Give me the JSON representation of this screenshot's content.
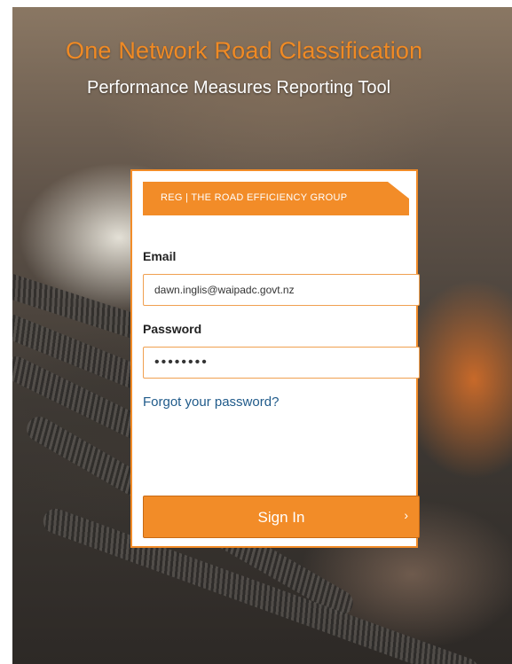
{
  "header": {
    "title": "One Network Road Classification",
    "subtitle": "Performance Measures Reporting Tool"
  },
  "brand": {
    "text": "REG  |  THE ROAD EFFICIENCY GROUP",
    "color": "#f28c28"
  },
  "form": {
    "email_label": "Email",
    "email_value": "dawn.inglis@waipadc.govt.nz",
    "password_label": "Password",
    "password_value": "••••••••",
    "forgot_link": "Forgot your password?",
    "signin_label": "Sign In",
    "signin_icon": "chevron-right-icon"
  },
  "colors": {
    "accent": "#f28c28",
    "link": "#1f5a8a"
  }
}
